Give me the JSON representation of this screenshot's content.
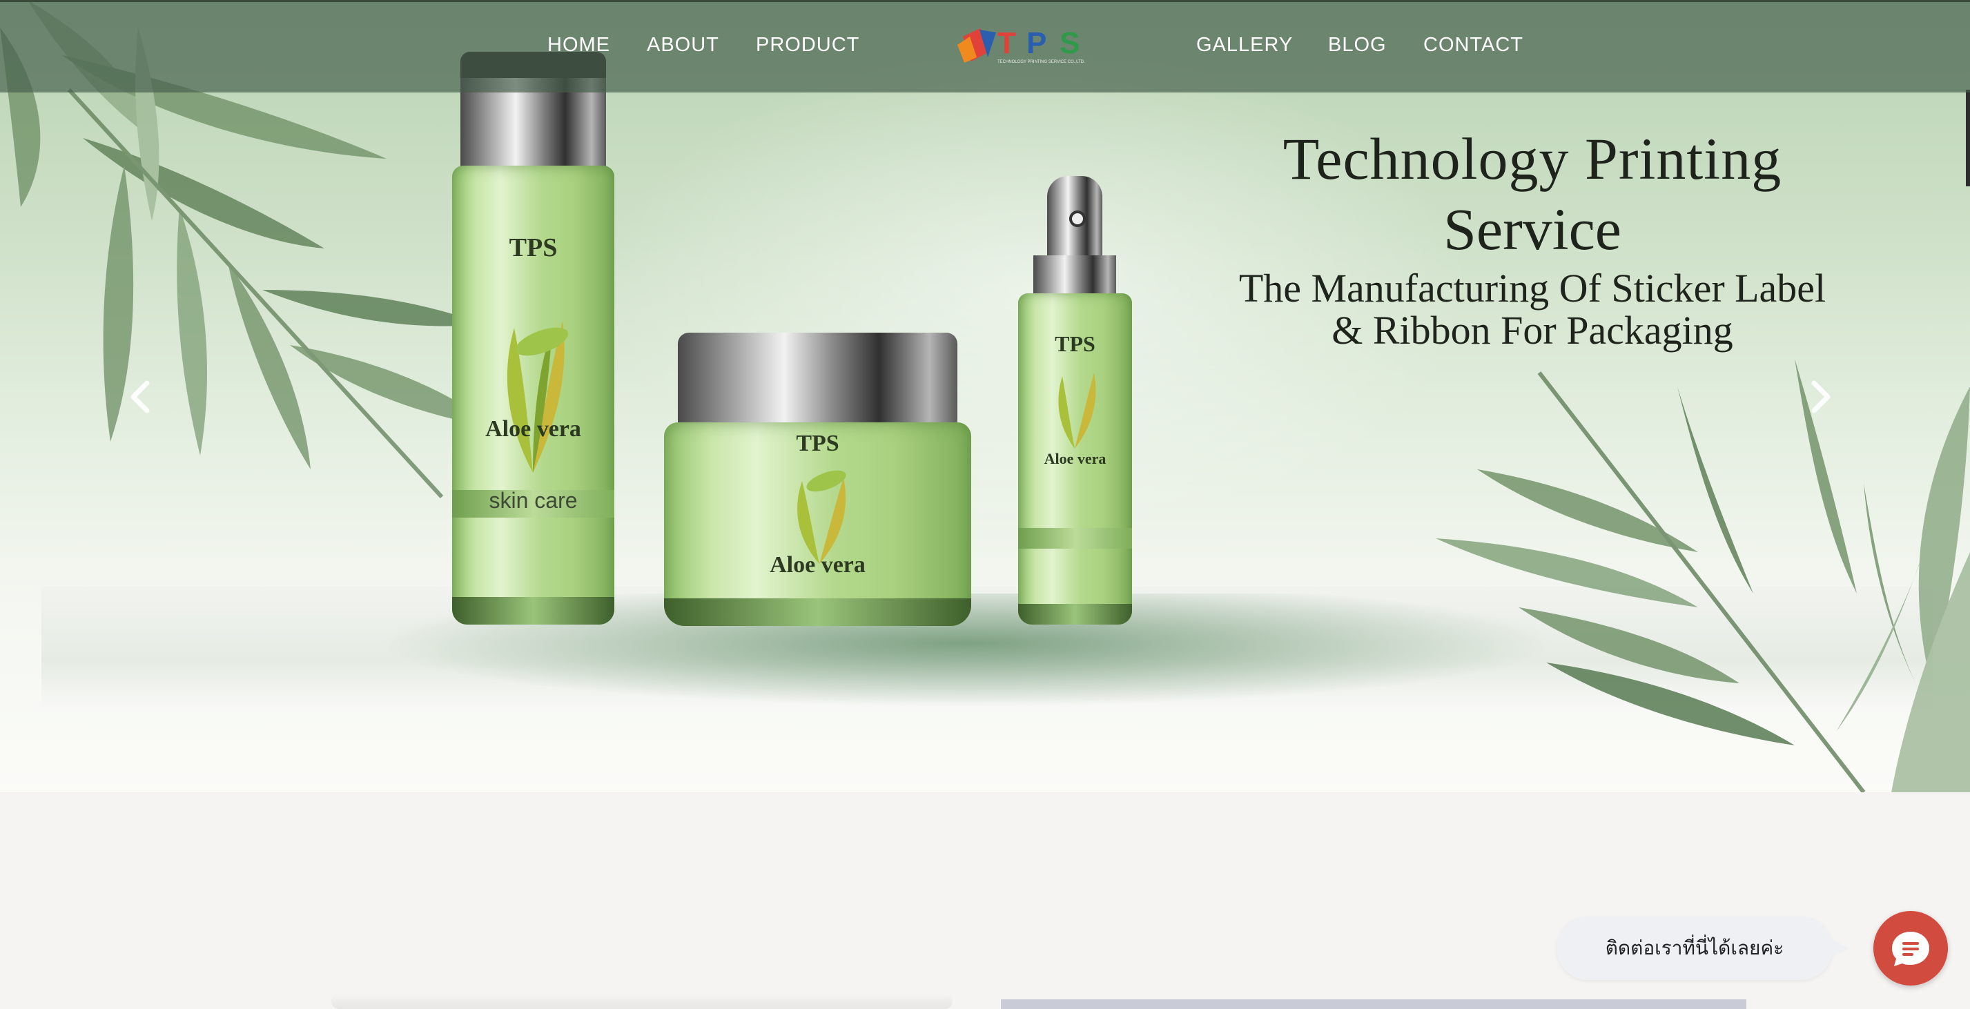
{
  "nav": {
    "left_items": [
      "HOME",
      "ABOUT",
      "PRODUCT"
    ],
    "right_items": [
      "GALLERY",
      "BLOG",
      "CONTACT"
    ],
    "logo_text": "TPS",
    "logo_subtext": "TECHNOLOGY PRINTING SERVICE CO.,LTD."
  },
  "hero": {
    "title_line1": "Technology Printing",
    "title_line2": "Service",
    "subtitle_line1": "The Manufacturing Of Sticker Label",
    "subtitle_line2": "& Ribbon For Packaging",
    "products": {
      "tall_bottle": {
        "brand": "TPS",
        "name": "Aloe vera",
        "band": "skin care"
      },
      "jar": {
        "brand": "TPS",
        "name": "Aloe vera"
      },
      "spray": {
        "brand": "TPS",
        "name": "Aloe vera"
      }
    },
    "prev_icon": "chevron-left-icon",
    "next_icon": "chevron-right-icon"
  },
  "chat": {
    "bubble_text": "ติดต่อเราที่นี่ได้เลยค่ะ",
    "button_icon": "chat-icon",
    "button_color": "#d24b3f"
  },
  "colors": {
    "nav_bg": "#465f4b",
    "page_bg": "#f6f4f2",
    "logo_red": "#e0423a",
    "logo_orange": "#f08a1e",
    "logo_blue": "#2a5fb0",
    "logo_green": "#2f9a4a"
  }
}
